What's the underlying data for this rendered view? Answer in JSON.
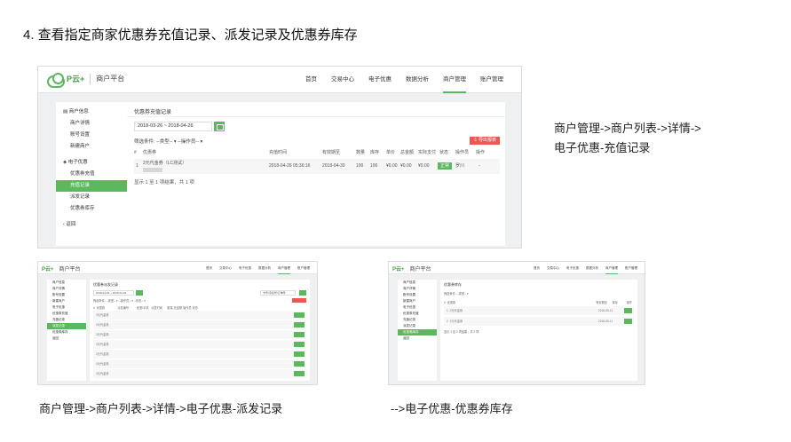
{
  "slide": {
    "title": "4. 查看指定商家优惠券充值记录、派发记录及优惠券库存",
    "captions": {
      "main_line1": "商户管理->商户列表->详情->",
      "main_line2": "电子优惠-充值记录",
      "left": "商户管理->商户列表->详情->电子优惠-派发记录",
      "right": "-->电子优惠-优惠券库存"
    }
  },
  "app": {
    "brand": "P云+",
    "brand_sub": "商户平台",
    "nav": [
      "首页",
      "交易中心",
      "电子优惠",
      "数据分析",
      "商户管理",
      "账户管理"
    ],
    "active_nav": "商户管理",
    "accent": "#5cb85c"
  },
  "sidebar": {
    "group1": "商户信息",
    "group1_items": [
      "商户详情",
      "账号设置",
      "新建商户"
    ],
    "group2": "电子优惠",
    "group2_items": [
      "优惠券充值",
      "充值记录",
      "派发记录",
      "优惠券库存"
    ],
    "back": "返回"
  },
  "main": {
    "panel_title": "优惠券充值记录",
    "date_range": "2018-03-26 ~ 2018-04-26",
    "filters": "筛选条件: --类型-- ▾   --操作员-- ▾",
    "export_label": "导出报表",
    "columns": [
      "#",
      "优惠券",
      "充值时间",
      "有效期至",
      "数量",
      "库存",
      "单价",
      "总金额",
      "实际支付",
      "状态",
      "操作员",
      "操作"
    ],
    "row": {
      "index": "1",
      "coupon": "2元代金券（LC测试）",
      "time": "2018-04-26 05:36:16",
      "expire": "2018-04-30",
      "qty": "100",
      "stock": "100",
      "price": "¥0.00",
      "total": "¥0.00",
      "paid": "¥0.00",
      "status": "正常",
      "operator": "罗川",
      "action": "-"
    },
    "summary": "显示 1 至 1 项结果，共 1 项"
  },
  "small_a": {
    "panel_title": "优惠券派发记录",
    "date_range": "2018-03-26 ~ 2018-04-26",
    "search_placeholder": "卡号/手机号/订单号",
    "filters": "筛选条件: --类型-- ▾  --操作员-- ▾  --状态-- ▾",
    "columns": [
      "#",
      "优惠券",
      "派发编号",
      "优惠/手机",
      "派发时间",
      "数量",
      "总金额",
      "操作员",
      "状态"
    ],
    "rows": [
      "2元代金券",
      "2元代金券",
      "2元代金券",
      "2元代金券",
      "2元代金券",
      "2元代金券",
      "2元代金券"
    ]
  },
  "small_b": {
    "panel_title": "优惠券库存",
    "filters": "筛选条件: --类型-- ▾",
    "columns": [
      "#",
      "优惠券",
      "有效期至",
      "库存",
      "操作"
    ],
    "rows": [
      {
        "index": "1",
        "coupon": "2元代金券",
        "expire": "2018-05-11"
      },
      {
        "index": "2",
        "coupon": "2元代金券",
        "expire": "2018-05-11"
      }
    ],
    "summary": "显示 1 至 2 项结果，共 2 项"
  }
}
